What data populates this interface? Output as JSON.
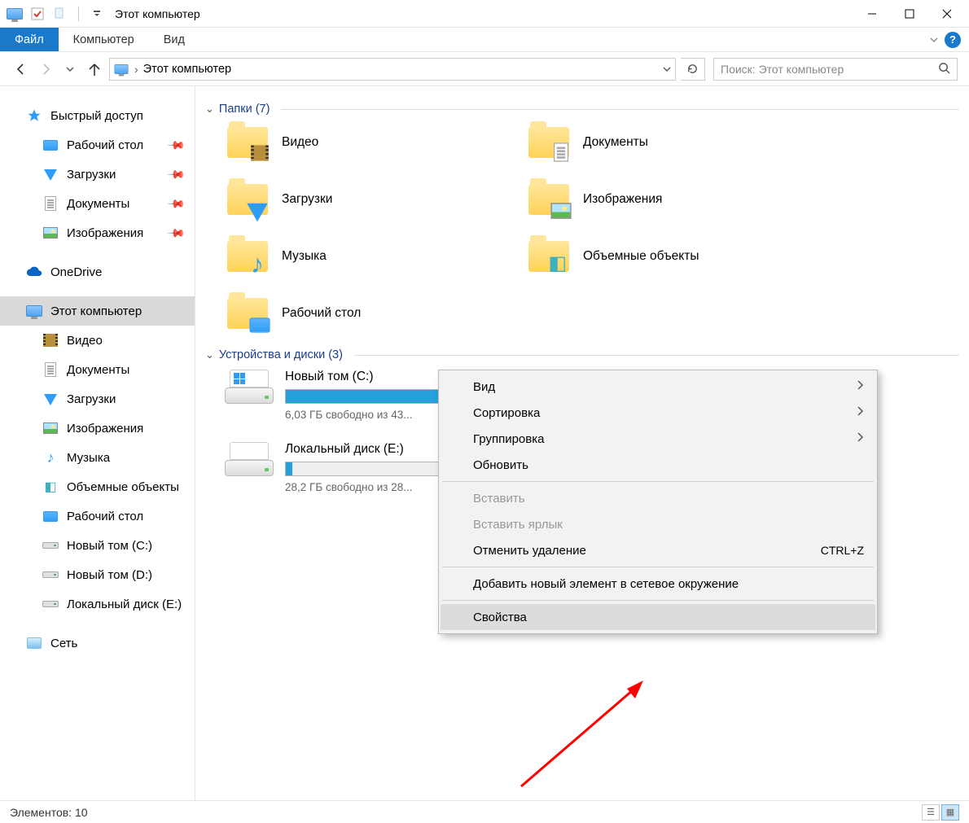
{
  "window": {
    "title": "Этот компьютер"
  },
  "ribbon": {
    "file": "Файл",
    "tabs": [
      "Компьютер",
      "Вид"
    ]
  },
  "address": {
    "path": "Этот компьютер",
    "sep": "›"
  },
  "search": {
    "placeholder": "Поиск: Этот компьютер"
  },
  "sidebar": {
    "quick": "Быстрый доступ",
    "quick_items": [
      {
        "label": "Рабочий стол",
        "icon": "desktop",
        "pinned": true
      },
      {
        "label": "Загрузки",
        "icon": "download",
        "pinned": true
      },
      {
        "label": "Документы",
        "icon": "doc",
        "pinned": true
      },
      {
        "label": "Изображения",
        "icon": "image",
        "pinned": true
      }
    ],
    "onedrive": "OneDrive",
    "thispc": "Этот компьютер",
    "pc_items": [
      {
        "label": "Видео",
        "icon": "video"
      },
      {
        "label": "Документы",
        "icon": "doc"
      },
      {
        "label": "Загрузки",
        "icon": "download"
      },
      {
        "label": "Изображения",
        "icon": "image"
      },
      {
        "label": "Музыка",
        "icon": "music"
      },
      {
        "label": "Объемные объекты",
        "icon": "cube"
      },
      {
        "label": "Рабочий стол",
        "icon": "desktop"
      },
      {
        "label": "Новый том (C:)",
        "icon": "drive-win"
      },
      {
        "label": "Новый том (D:)",
        "icon": "drive"
      },
      {
        "label": "Локальный диск (E:)",
        "icon": "drive"
      }
    ],
    "network": "Сеть"
  },
  "groups": {
    "folders": {
      "title": "Папки",
      "count": 7
    },
    "devices": {
      "title": "Устройства и диски",
      "count": 3
    }
  },
  "folders": [
    {
      "label": "Видео",
      "overlay": "video"
    },
    {
      "label": "Документы",
      "overlay": "doc"
    },
    {
      "label": "Загрузки",
      "overlay": "download"
    },
    {
      "label": "Изображения",
      "overlay": "image"
    },
    {
      "label": "Музыка",
      "overlay": "music"
    },
    {
      "label": "Объемные объекты",
      "overlay": "cube"
    },
    {
      "label": "Рабочий стол",
      "overlay": "desktop"
    }
  ],
  "drives": [
    {
      "name": "Новый том (C:)",
      "free_text": "6,03 ГБ свободно из 43...",
      "fill_pct": 86,
      "os": true
    },
    {
      "name": "Локальный диск (E:)",
      "free_text": "28,2 ГБ свободно из 28...",
      "fill_pct": 2,
      "os": false
    }
  ],
  "context_menu": {
    "items": [
      {
        "label": "Вид",
        "submenu": true
      },
      {
        "label": "Сортировка",
        "submenu": true
      },
      {
        "label": "Группировка",
        "submenu": true
      },
      {
        "label": "Обновить"
      },
      {
        "sep": true
      },
      {
        "label": "Вставить",
        "disabled": true
      },
      {
        "label": "Вставить ярлык",
        "disabled": true
      },
      {
        "label": "Отменить удаление",
        "shortcut": "CTRL+Z"
      },
      {
        "sep": true
      },
      {
        "label": "Добавить новый элемент в сетевое окружение"
      },
      {
        "sep": true
      },
      {
        "label": "Свойства",
        "highlight": true
      }
    ]
  },
  "status": {
    "elements_label": "Элементов:",
    "elements_count": 10
  }
}
